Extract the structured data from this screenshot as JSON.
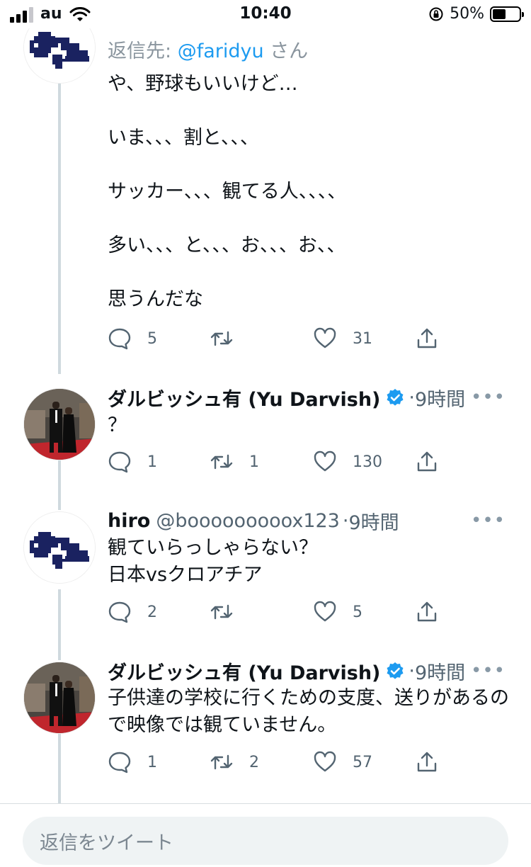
{
  "status_bar": {
    "carrier": "au",
    "time": "10:40",
    "battery_percent": "50%",
    "battery_level": 0.5
  },
  "top_tweet": {
    "replying_prefix": "返信先: ",
    "replying_mention": "@faridyu",
    "replying_suffix": " さん",
    "text": "や、野球もいいけど…\n\nいま、、、割と、、、\n\nサッカー、、、観てる人、、、、\n\n多い、、、と、、、お、、、お、、\n\n思うんだな",
    "reply_count": "5",
    "retweet_count": "",
    "like_count": "31"
  },
  "tweets": [
    {
      "name": "ダルビッシュ有 (Yu Darvish)",
      "handle": "",
      "verified": true,
      "time": "9時間",
      "text": "？",
      "reply_count": "1",
      "retweet_count": "1",
      "like_count": "130"
    },
    {
      "name": "hiro",
      "handle": "@booooooooox123",
      "verified": false,
      "time": "9時間",
      "text": "観ていらっしゃらない？\n日本vsクロアチア",
      "reply_count": "2",
      "retweet_count": "",
      "like_count": "5"
    },
    {
      "name": "ダルビッシュ有 (Yu Darvish)",
      "handle": "",
      "verified": true,
      "time": "9時間",
      "text": "子供達の学校に行くための支度、送りがあるので映像では観ていません。",
      "reply_count": "1",
      "retweet_count": "2",
      "like_count": "57"
    }
  ],
  "separator": "·",
  "more_glyph": "•••",
  "composer": {
    "placeholder": "返信をツイート"
  },
  "colors": {
    "accent": "#1d9bf0",
    "text_primary": "#0f1419",
    "text_secondary": "#536471",
    "thread_line": "#cfd9de",
    "composer_bg": "#eff3f4"
  },
  "icons": {
    "reply": "speech-bubble-icon",
    "retweet": "retweet-arrows-icon",
    "like": "heart-outline-icon",
    "share": "share-upload-icon",
    "verified": "verified-badge-icon"
  }
}
